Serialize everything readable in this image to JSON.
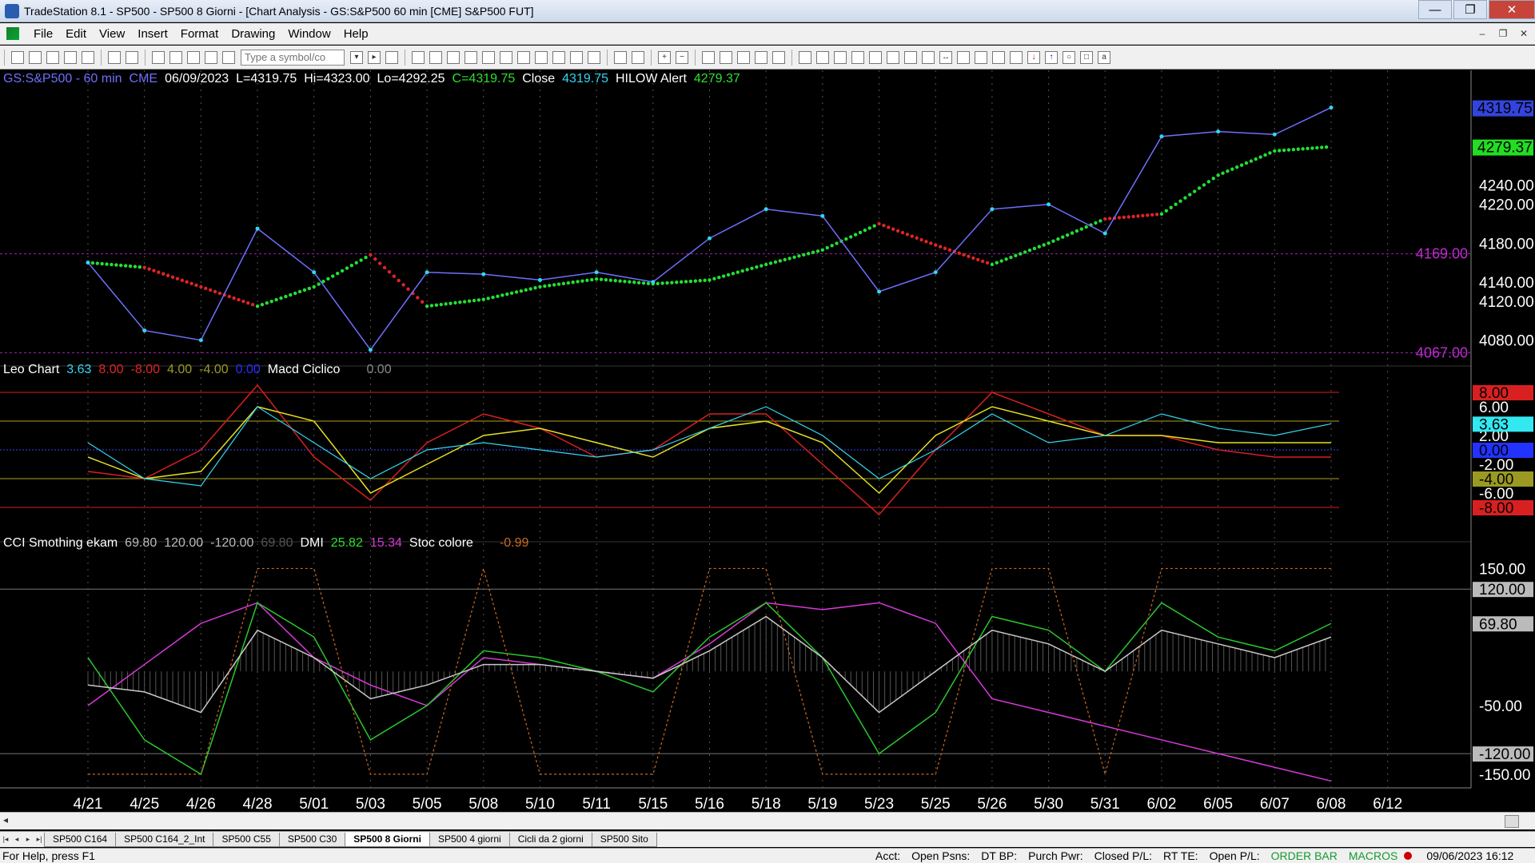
{
  "window": {
    "title": "TradeStation 8.1 - SP500 - SP500 8 Giorni - [Chart Analysis - GS:S&P500  60 min  [CME] S&P500 FUT]",
    "min_label": "—",
    "max_label": "❐",
    "close_label": "✕"
  },
  "menu": [
    "File",
    "Edit",
    "View",
    "Insert",
    "Format",
    "Drawing",
    "Window",
    "Help"
  ],
  "toolbar": {
    "symbol_placeholder": "Type a symbol/co"
  },
  "header": {
    "symbol": "GS:S&P500 - 60 min",
    "exchange": "CME",
    "date": "06/09/2023",
    "last": "L=4319.75",
    "high": "Hi=4323.00",
    "low": "Lo=4292.25",
    "close": "C=4319.75",
    "close_label": "Close",
    "close_value": "4319.75",
    "alert_label": "HILOW Alert",
    "alert_value": "4279.37"
  },
  "panel2_legend": {
    "name": "Leo Chart",
    "v1": "3.63",
    "v2": "8.00",
    "v3": "-8.00",
    "v4": "4.00",
    "v5": "-4.00",
    "v6": "0.00",
    "name2": "Macd Ciclico",
    "v7": "0.00"
  },
  "panel3_legend": {
    "name": "CCI Smothing ekam",
    "v1": "69.80",
    "v2": "120.00",
    "v3": "-120.00",
    "v4": "69.80",
    "name2": "DMI",
    "v5": "25.82",
    "v6": "15.34",
    "name3": "Stoc colore",
    "v7": "-0.99"
  },
  "price_axis": {
    "labels": [
      "4319.75",
      "4279.37",
      "4240.00",
      "4220.00",
      "4180.00",
      "4140.00",
      "4120.00",
      "4080.00"
    ],
    "level_high": "4169.00",
    "level_low": "4067.00"
  },
  "macd_axis": {
    "labels": [
      "8.00",
      "6.00",
      "3.63",
      "2.00",
      "0.00",
      "-2.00",
      "-4.00",
      "-6.00",
      "-8.00"
    ]
  },
  "cci_axis": {
    "labels": [
      "150.00",
      "120.00",
      "69.80",
      "-50.00",
      "-120.00",
      "-150.00"
    ]
  },
  "dates": [
    "4/21",
    "4/25",
    "4/26",
    "4/28",
    "5/01",
    "5/03",
    "5/05",
    "5/08",
    "5/10",
    "5/11",
    "5/15",
    "5/16",
    "5/18",
    "5/19",
    "5/23",
    "5/25",
    "5/26",
    "5/30",
    "5/31",
    "6/02",
    "6/05",
    "6/07",
    "6/08",
    "6/12"
  ],
  "colors": {
    "price": "#6f6fff",
    "price_dots": "#33d6f0",
    "trend_up": "#22e033",
    "trend_down": "#e02424",
    "macd_yellow": "#e5e022",
    "macd_red": "#d92020",
    "macd_cyan": "#33d6f0",
    "cci_magenta": "#d83ad8",
    "cci_green": "#29c72c",
    "cci_white": "#c9c9c9",
    "stoch_orange": "#cc6a20"
  },
  "chart_data": {
    "type": "line",
    "title": "GS:S&P500 - 60 min",
    "x": [
      "4/21",
      "4/25",
      "4/26",
      "4/28",
      "5/01",
      "5/03",
      "5/05",
      "5/08",
      "5/10",
      "5/11",
      "5/15",
      "5/16",
      "5/18",
      "5/19",
      "5/23",
      "5/25",
      "5/26",
      "5/30",
      "5/31",
      "6/02",
      "6/05",
      "6/07",
      "6/08"
    ],
    "series": [
      {
        "name": "Close",
        "values": [
          4160,
          4090,
          4080,
          4195,
          4150,
          4070,
          4150,
          4148,
          4142,
          4150,
          4140,
          4185,
          4215,
          4208,
          4130,
          4150,
          4215,
          4220,
          4190,
          4290,
          4295,
          4292,
          4319.75
        ]
      },
      {
        "name": "HILOW Alert",
        "values": [
          4160,
          4155,
          4135,
          4115,
          4135,
          4168,
          4115,
          4122,
          4135,
          4143,
          4138,
          4142,
          4158,
          4173,
          4200,
          4178,
          4158,
          4180,
          4205,
          4210,
          4250,
          4275,
          4279.37
        ]
      }
    ],
    "ylim": [
      4060,
      4340
    ],
    "price_labels": [
      4240,
      4220,
      4180,
      4140,
      4120,
      4080
    ],
    "macd_ylim": [
      -9,
      10
    ],
    "macd_levels": [
      8,
      6,
      2,
      0,
      -2,
      -4,
      -6,
      -8
    ],
    "macd_cyan": [
      1,
      -4,
      -5,
      6,
      1,
      -4,
      0,
      1,
      0,
      -1,
      0,
      3,
      6,
      2,
      -4,
      0,
      5,
      1,
      2,
      5,
      3,
      2,
      3.63
    ],
    "macd_yellow": [
      -1,
      -4,
      -3,
      6,
      4,
      -6,
      -2,
      2,
      3,
      1,
      -1,
      3,
      4,
      1,
      -6,
      2,
      6,
      4,
      2,
      2,
      1,
      1,
      1
    ],
    "macd_red": [
      -3,
      -4,
      0,
      9,
      -1,
      -7,
      1,
      5,
      3,
      -1,
      0,
      5,
      5,
      -2,
      -9,
      0,
      8,
      5,
      2,
      2,
      0,
      -1,
      -1
    ],
    "cci_ylim": [
      -170,
      175
    ],
    "cci_levels": [
      150,
      120,
      -50,
      -120,
      -150
    ],
    "cci_green": [
      20,
      -100,
      -150,
      100,
      50,
      -100,
      -50,
      30,
      20,
      0,
      -30,
      50,
      100,
      20,
      -120,
      -60,
      80,
      60,
      0,
      100,
      50,
      30,
      69.8
    ],
    "cci_magenta": [
      -50,
      10,
      70,
      100,
      20,
      -20,
      -50,
      20,
      10,
      0,
      -10,
      40,
      100,
      90,
      100,
      70,
      -40,
      -60,
      -80,
      -100,
      -120,
      -140,
      -160
    ],
    "cci_white": [
      -20,
      -30,
      -60,
      60,
      20,
      -40,
      -20,
      10,
      10,
      0,
      -10,
      30,
      80,
      20,
      -60,
      0,
      60,
      40,
      0,
      60,
      40,
      20,
      50
    ]
  },
  "sheet_tabs": [
    "SP500 C164",
    "SP500 C164_2_Int",
    "SP500 C55",
    "SP500 C30",
    "SP500 8 Giorni",
    "SP500 4 giorni",
    "Cicli da 2 giorni",
    "SP500 Sito"
  ],
  "active_tab": "SP500 8 Giorni",
  "status": {
    "help": "For Help, press F1",
    "acct": "Acct:",
    "open_psns": "Open Psns:",
    "dt_bp": "DT BP:",
    "purch_pwr": "Purch Pwr:",
    "closed_pl": "Closed P/L:",
    "rt_te": "RT TE:",
    "open_pl": "Open P/L:",
    "order_bar": "ORDER BAR",
    "macros": "MACROS",
    "datetime": "09/06/2023 16:12"
  }
}
